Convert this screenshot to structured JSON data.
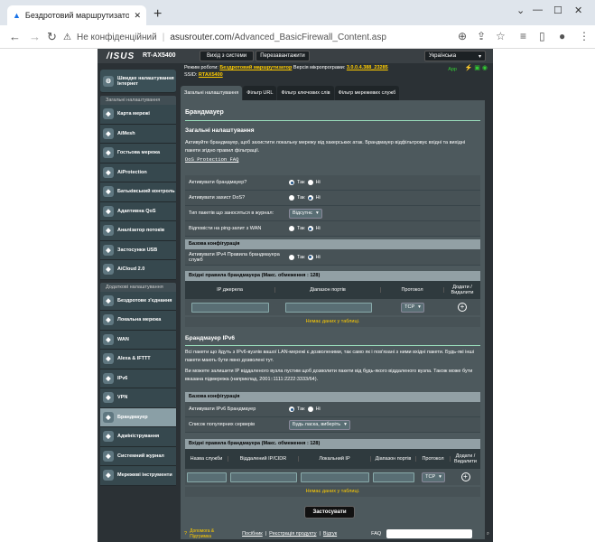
{
  "browser": {
    "tab_title": "Бездротовий маршрутизатор AS",
    "new_tab": "+",
    "url_security": "Не конфіденційний",
    "url_host": "asusrouter.com",
    "url_path": "/Advanced_BasicFirewall_Content.asp"
  },
  "router": {
    "brand": "/ISUS",
    "model": "RT-AX5400",
    "logout": "Вихід з системи",
    "reboot": "Перезавантажити",
    "language": "Українська",
    "mode_label": "Режим роботи:",
    "mode_value": "Бездротовий маршрутизатор",
    "fw_label": "Версія мікропрограми:",
    "fw_value": "3.0.0.4.388_23285",
    "ssid_label": "SSID:",
    "ssid_value": "RTAX5400",
    "app_label": "App"
  },
  "sidebar": {
    "quick": "Швидке налаштування Інтернет",
    "general_head": "Загальні налаштування",
    "general": [
      {
        "label": "Карта мережі",
        "icon": "map-icon"
      },
      {
        "label": "AiMesh",
        "icon": "mesh-icon"
      },
      {
        "label": "Гостьова мережа",
        "icon": "guest-icon"
      },
      {
        "label": "AiProtection",
        "icon": "shield-icon"
      },
      {
        "label": "Батьківський контроль",
        "icon": "family-icon"
      },
      {
        "label": "Адаптивна QoS",
        "icon": "qos-icon"
      },
      {
        "label": "Аналізатор потоків",
        "icon": "traffic-icon"
      },
      {
        "label": "Застосунки USB",
        "icon": "usb-icon"
      },
      {
        "label": "AiCloud 2.0",
        "icon": "cloud-icon"
      }
    ],
    "advanced_head": "Додаткові налаштування",
    "advanced": [
      {
        "label": "Бездротове з'єднання",
        "icon": "wifi-icon"
      },
      {
        "label": "Локальна мережа",
        "icon": "lan-icon"
      },
      {
        "label": "WAN",
        "icon": "globe-icon"
      },
      {
        "label": "Alexa & IFTTT",
        "icon": "alexa-icon"
      },
      {
        "label": "IPv6",
        "icon": "ipv6-icon"
      },
      {
        "label": "VPN",
        "icon": "vpn-icon"
      },
      {
        "label": "Брандмауер",
        "icon": "firewall-icon"
      },
      {
        "label": "Адміністрування",
        "icon": "admin-icon"
      },
      {
        "label": "Системний журнал",
        "icon": "log-icon"
      },
      {
        "label": "Мережеві інструменти",
        "icon": "tools-icon"
      }
    ]
  },
  "tabs": [
    "Загальні налаштування",
    "Фільтр URL",
    "Фільтр ключових слів",
    "Фільтр мережевих служб"
  ],
  "main": {
    "title": "Брандмауер",
    "subtitle": "Загальні налаштування",
    "desc": "Активуйте брандмауер, щоб захистити локальну мережу від хакерських атак. Брандмауер відфільтровує вхідні та вихідні пакети згідно правил фільтрації.",
    "dos_faq": "DoS Protection FAQ",
    "rows": [
      {
        "label": "Активувати брандмауер?",
        "yes": "Так",
        "no": "Ні"
      },
      {
        "label": "Активувати захист DoS?",
        "yes": "Так",
        "no": "Ні"
      },
      {
        "label": "Тип пакетів що заносяться в журнал:",
        "select": "Відсутнє"
      },
      {
        "label": "Відповісти на ping-запит з WAN",
        "yes": "Так",
        "no": "Ні"
      }
    ],
    "basic_config": "Базова конфігурація",
    "ipv4_inbound_label": "Активувати IPv4 Правила брандмауера служб",
    "ipv4_yes": "Так",
    "ipv4_no": "Ні",
    "inbound_head": "Вхідні правила брандмауера (Макс. обмеження : 128)",
    "col_src_ip": "IP джерела",
    "col_port_range": "Діапазон портів",
    "col_protocol": "Протокол",
    "col_add_del": "Додати / Видалити",
    "protocol_value": "TCP",
    "no_data": "Немає даних у таблиці.",
    "ipv6_title": "Брандмауер IPv6",
    "ipv6_desc1": "Всі пакети що йдуть з IPv6-вузлів вашої LAN-мережі є дозволеними, так само як і пов'язані з ними вхідні пакети. Будь-які інші пакети мають бути явно дозволені тут.",
    "ipv6_desc2": "Ви можете залишити IP віддаленого вузла пустим щоб дозволити пакети від будь-якого віддаленого вузла. Також може бути вказана підмережа (наприклад, 2001::1111:2222:3333/64).",
    "ipv6_basic": "Базова конфігурація",
    "ipv6_enable_label": "Активувати IPv6 Брандмауер",
    "ipv6_yes": "Так",
    "ipv6_no": "Ні",
    "known_servers_label": "Список популярних серверів",
    "known_servers_value": "Будь ласка, виберіть",
    "ipv6_inbound_head": "Вхідні правила брандмауера (Макс. обмеження : 128)",
    "col6_service": "Назва служби",
    "col6_remote": "Віддалений IP/CIDR",
    "col6_local": "Локальний IP",
    "col6_ports": "Діапазон портів",
    "col6_protocol": "Протокол",
    "col6_add": "Додати / Видалити",
    "protocol6_value": "TCP",
    "no_data6": "Немає даних у таблиці.",
    "apply": "Застосувати"
  },
  "footer": {
    "help": "Допомога & Підтримка",
    "manual": "Посібник",
    "reg": "Реєстрація продукту",
    "feedback": "Відгук",
    "faq": "FAQ"
  }
}
